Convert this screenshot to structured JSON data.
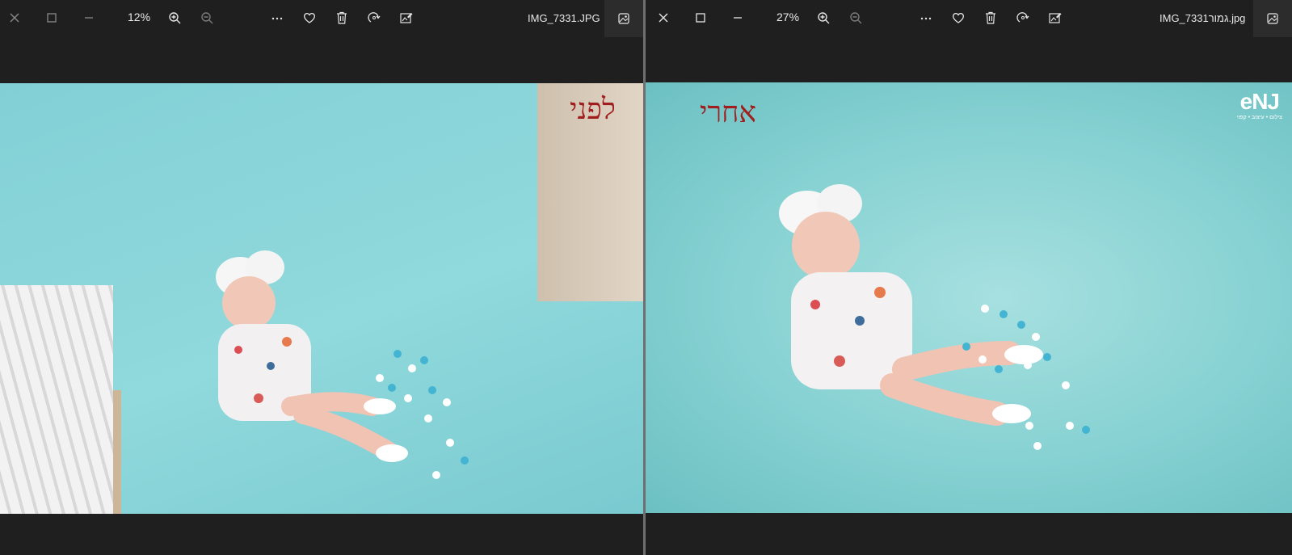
{
  "left_window": {
    "zoom": "12%",
    "filename": "IMG_7331.JPG",
    "photo_label": "לפני"
  },
  "right_window": {
    "zoom": "27%",
    "filename": "IMG_7331גמור.jpg",
    "photo_label": "אחרי",
    "logo_text": "eNJ",
    "logo_subtext": "צילום • עיצוב • קפוי"
  },
  "icons": {
    "close": "close-icon",
    "maximize": "maximize-icon",
    "minimize": "minimize-icon",
    "zoom_in": "zoom-in-icon",
    "zoom_out": "zoom-out-icon",
    "more": "more-icon",
    "favorite": "heart-icon",
    "delete": "trash-icon",
    "rotate": "rotate-icon",
    "edit": "edit-image-icon",
    "gallery": "gallery-icon"
  },
  "colors": {
    "window_bg": "#202020",
    "toolbar_text": "#e6e6e6",
    "photo_bg_left": "#86d4d9",
    "photo_bg_right": "#86d1d2",
    "label_red": "#a01e1e",
    "divider": "#6f6f6f"
  }
}
